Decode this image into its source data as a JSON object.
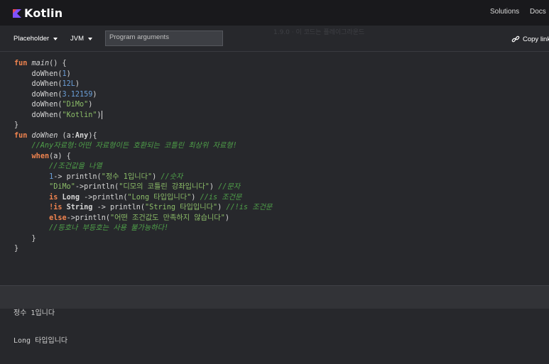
{
  "nav": {
    "brand": "Kotlin",
    "links": [
      "Solutions",
      "Docs"
    ]
  },
  "toolbar": {
    "version": "Placeholder",
    "target": "JVM",
    "args_placeholder": "Program arguments",
    "copy_link": "Copy link",
    "ghost_text": "1.9.0 · 이 코드는 플레이그라운드"
  },
  "code_lines": [
    [
      [
        "kw",
        "fun "
      ],
      [
        "fn",
        "main"
      ],
      [
        "p",
        "() {"
      ]
    ],
    [
      [
        "p",
        "    doWhen("
      ],
      [
        "num",
        "1"
      ],
      [
        "p",
        ")"
      ]
    ],
    [
      [
        "p",
        "    doWhen("
      ],
      [
        "num",
        "12L"
      ],
      [
        "p",
        ")"
      ]
    ],
    [
      [
        "p",
        "    doWhen("
      ],
      [
        "num",
        "3.12159"
      ],
      [
        "p",
        ")"
      ]
    ],
    [
      [
        "p",
        "    doWhen("
      ],
      [
        "str",
        "\"DiMo\""
      ],
      [
        "p",
        ")"
      ]
    ],
    [
      [
        "p",
        "    doWhen("
      ],
      [
        "str",
        "\"Kotlin\""
      ],
      [
        "p",
        ")"
      ]
    ],
    [
      [
        "p",
        "}"
      ]
    ],
    [
      [
        "kw",
        "fun "
      ],
      [
        "fn",
        "doWhen"
      ],
      [
        "p",
        " (a:"
      ],
      [
        "kwb",
        "Any"
      ],
      [
        "p",
        "){"
      ]
    ],
    [
      [
        "cm",
        "    //Any자료형:어떤 자료형이든 호환되는 코틀린 최상위 자료형!"
      ]
    ],
    [
      [
        "p",
        "    "
      ],
      [
        "kw",
        "when"
      ],
      [
        "p",
        "(a) {"
      ]
    ],
    [
      [
        "cm",
        "        //조건값을 나열"
      ]
    ],
    [
      [
        "p",
        "        "
      ],
      [
        "num",
        "1"
      ],
      [
        "p",
        "-> println("
      ],
      [
        "str",
        "\"정수 1입니다\""
      ],
      [
        "p",
        ") "
      ],
      [
        "cm",
        "//숫자"
      ]
    ],
    [
      [
        "p",
        "        "
      ],
      [
        "str",
        "\"DiMo\""
      ],
      [
        "p",
        "->println("
      ],
      [
        "str",
        "\"디모의 코틀린 강좌입니다\""
      ],
      [
        "p",
        ") "
      ],
      [
        "cm",
        "//문자"
      ]
    ],
    [
      [
        "p",
        "        "
      ],
      [
        "kw",
        "is "
      ],
      [
        "kwb",
        "Long"
      ],
      [
        "p",
        " ->println("
      ],
      [
        "str",
        "\"Long 타입입니다\""
      ],
      [
        "p",
        ") "
      ],
      [
        "cm",
        "//is 조건문"
      ]
    ],
    [
      [
        "p",
        "        "
      ],
      [
        "kw",
        "!is "
      ],
      [
        "kwb",
        "String"
      ],
      [
        "p",
        " -> println("
      ],
      [
        "str",
        "\"String 타입입니다\""
      ],
      [
        "p",
        ") "
      ],
      [
        "cm",
        "//!is 조건문"
      ]
    ],
    [
      [
        "p",
        "        "
      ],
      [
        "kw",
        "else"
      ],
      [
        "p",
        "->println("
      ],
      [
        "str",
        "\"어떤 조건값도 만족하지 않습니다\""
      ],
      [
        "p",
        ")"
      ]
    ],
    [
      [
        "cm",
        "        //등호나 부등호는 사용 불가능하다!"
      ]
    ],
    [
      [
        "p",
        "    }"
      ]
    ],
    [
      [
        "p",
        "}"
      ]
    ]
  ],
  "output": {
    "lines": [
      "정수 1입니다",
      "Long 타입입니다"
    ]
  },
  "colors": {
    "keyword": "#f1844f",
    "number": "#6b9fd8",
    "string": "#8cbd68",
    "comment": "#4fa049",
    "brand": "#7f52ff"
  },
  "icons": {
    "brand": "kotlin-logo-icon",
    "link": "link-icon",
    "dropdown": "caret-down-icon"
  }
}
